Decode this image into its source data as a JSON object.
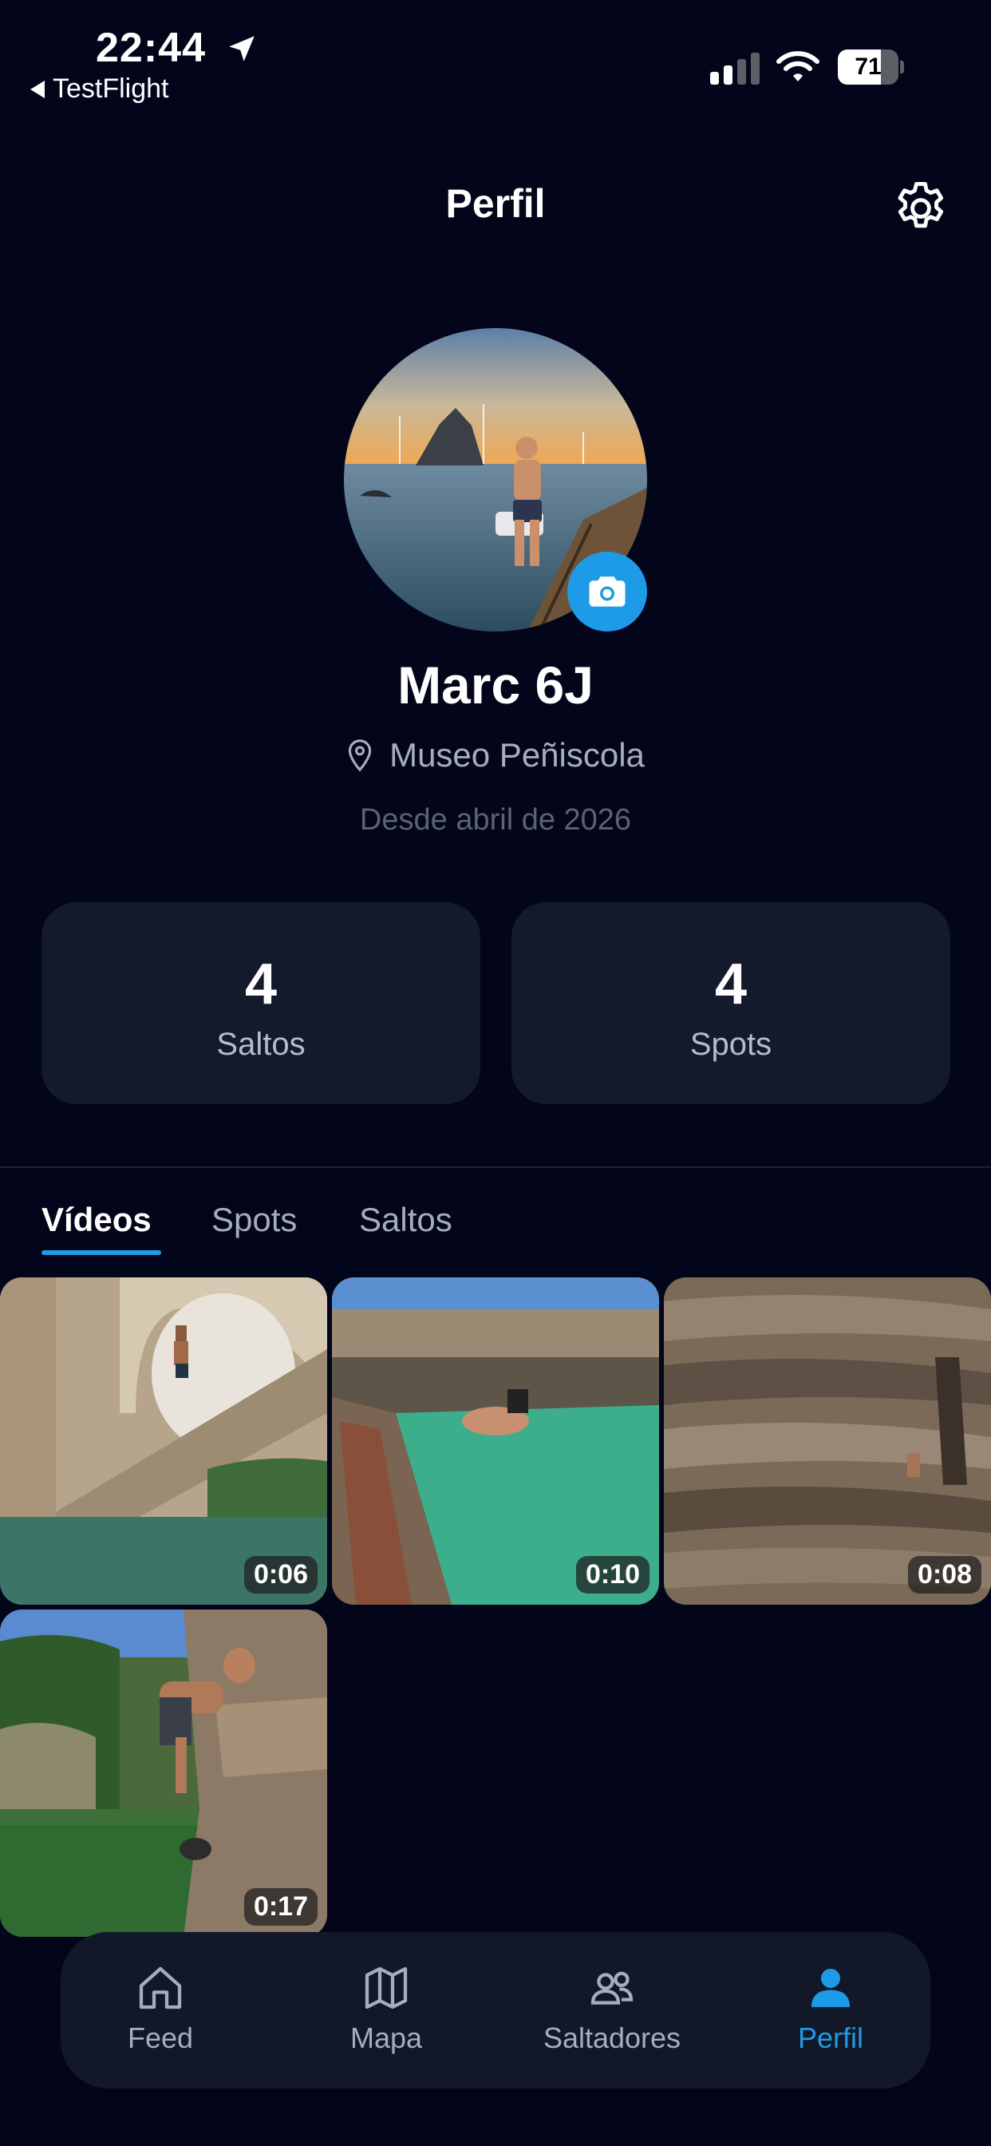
{
  "status_bar": {
    "time": "22:44",
    "back_app": "TestFlight",
    "battery": "71",
    "battery_level": 0.71
  },
  "header": {
    "title": "Perfil"
  },
  "profile": {
    "name": "Marc 6J",
    "location": "Museo Peñiscola",
    "since": "Desde abril de 2026"
  },
  "stats": [
    {
      "value": "4",
      "label": "Saltos"
    },
    {
      "value": "4",
      "label": "Spots"
    }
  ],
  "tabs": [
    {
      "label": "Vídeos",
      "active": true
    },
    {
      "label": "Spots",
      "active": false
    },
    {
      "label": "Saltos",
      "active": false
    }
  ],
  "videos": [
    {
      "duration": "0:06"
    },
    {
      "duration": "0:10"
    },
    {
      "duration": "0:08"
    },
    {
      "duration": "0:17"
    }
  ],
  "bottom_nav": [
    {
      "label": "Feed",
      "icon": "home-icon"
    },
    {
      "label": "Mapa",
      "icon": "map-icon"
    },
    {
      "label": "Saltadores",
      "icon": "users-icon"
    },
    {
      "label": "Perfil",
      "icon": "person-icon",
      "active": true
    }
  ],
  "colors": {
    "background": "#03061a",
    "card": "#131a2b",
    "accent": "#1e9be6"
  }
}
